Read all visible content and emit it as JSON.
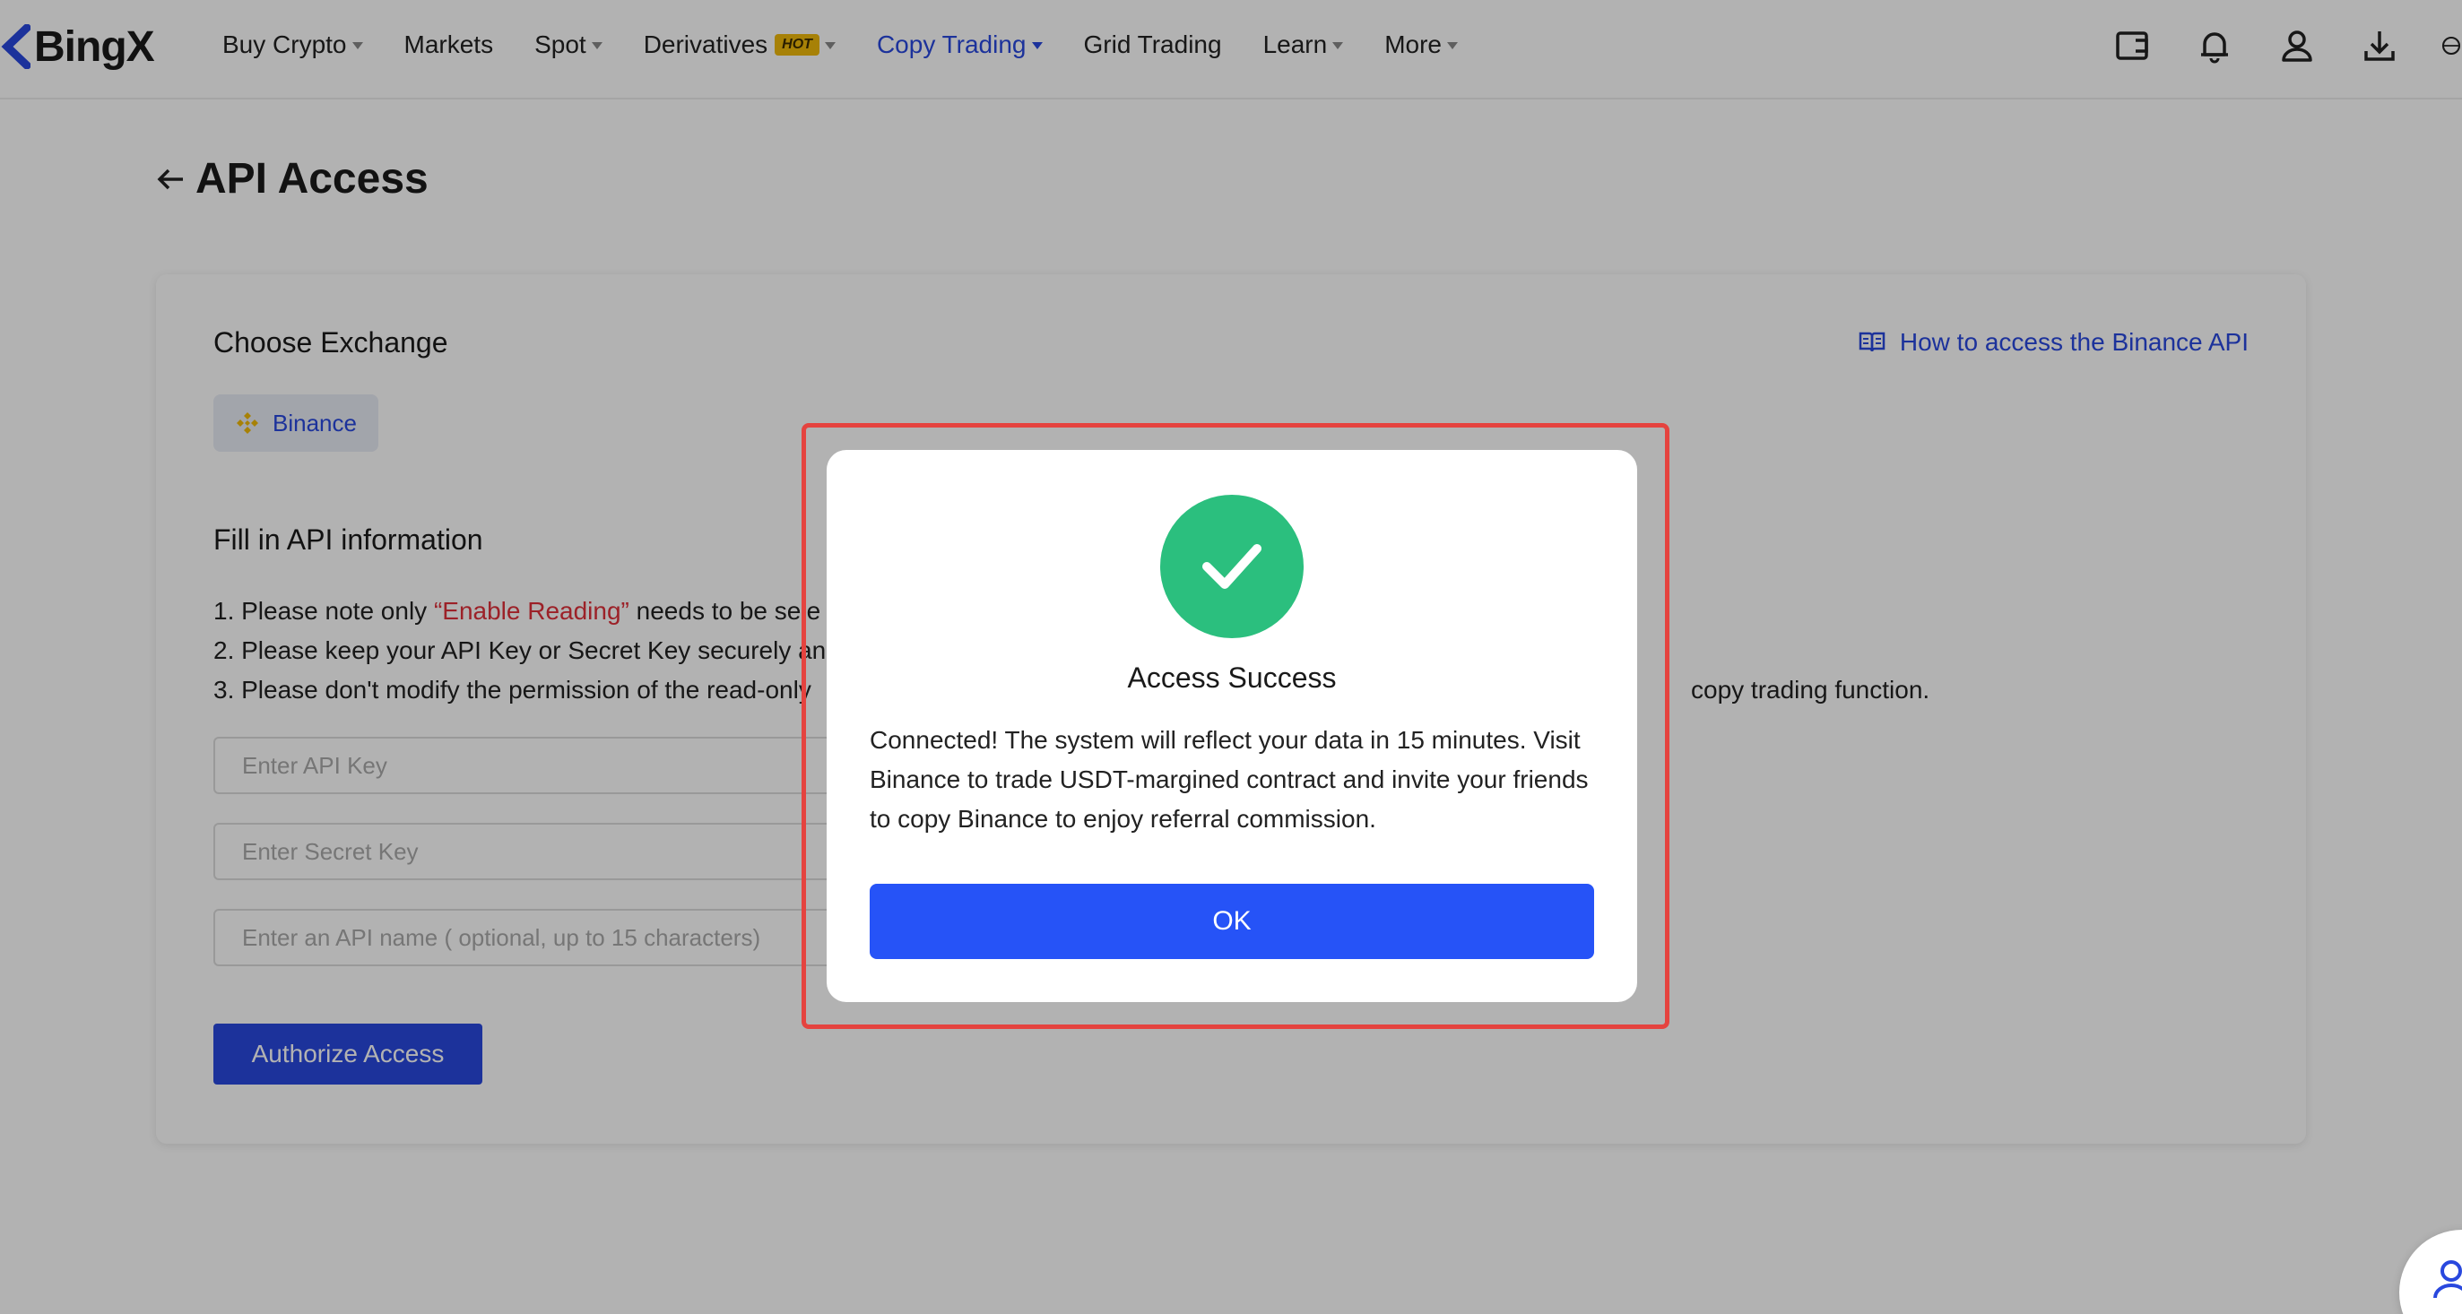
{
  "header": {
    "logo_text": "BingX",
    "nav": [
      {
        "label": "Buy Crypto",
        "dropdown": true
      },
      {
        "label": "Markets",
        "dropdown": false
      },
      {
        "label": "Spot",
        "dropdown": true
      },
      {
        "label": "Derivatives",
        "badge": "HOT",
        "dropdown": true
      },
      {
        "label": "Copy Trading",
        "dropdown": true,
        "active": true
      },
      {
        "label": "Grid Trading",
        "dropdown": false
      },
      {
        "label": "Learn",
        "dropdown": true
      },
      {
        "label": "More",
        "dropdown": true
      }
    ],
    "icons": [
      "wallet-icon",
      "bell-icon",
      "user-icon",
      "download-icon",
      "globe-icon"
    ]
  },
  "page": {
    "title": "API Access",
    "choose_exchange_label": "Choose Exchange",
    "guide_link": "How to access the Binance API",
    "exchange": "Binance",
    "fill_info_label": "Fill in API information",
    "notes": {
      "line1_prefix": "1. Please note only ",
      "line1_highlight": "“Enable Reading”",
      "line1_suffix": " needs to be sele",
      "line2": "2. Please keep your API Key or Secret Key securely an",
      "line3_prefix": "3. Please don't modify the permission of the read-only",
      "line3_suffix": "copy trading function."
    },
    "inputs": {
      "api_key_placeholder": "Enter API Key",
      "secret_key_placeholder": "Enter Secret Key",
      "api_name_placeholder": "Enter an API name ( optional, up to 15 characters)"
    },
    "authorize_button": "Authorize Access"
  },
  "modal": {
    "title": "Access Success",
    "body": "Connected! The system will reflect your data in 15 minutes. Visit Binance to trade USDT-margined contract and invite your friends to copy Binance to enjoy referral commission.",
    "ok_button": "OK"
  },
  "colors": {
    "brand_blue": "#2948de",
    "success_green": "#2bbf7e",
    "highlight_red": "#e5433f",
    "hot_badge": "#f0b90b"
  }
}
